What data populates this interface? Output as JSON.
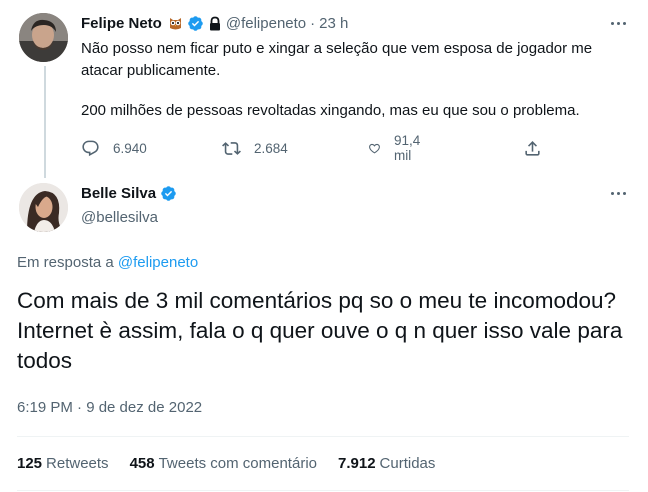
{
  "parent_tweet": {
    "author_name": "Felipe Neto",
    "handle": "@felipeneto",
    "time": "23 h",
    "separator": "·",
    "text_p1": "Não posso nem ficar puto e xingar a seleção que vem esposa de jogador me atacar publicamente.",
    "text_p2": "200 milhões de pessoas revoltadas xingando, mas eu que sou o problema.",
    "replies": "6.940",
    "retweets": "2.684",
    "likes": "91,4 mil"
  },
  "main_tweet": {
    "author_name": "Belle Silva",
    "handle": "@bellesilva",
    "reply_prefix": "Em resposta a",
    "reply_to": "@felipeneto",
    "text": "Com mais de 3 mil comentários pq so o meu te incomodou? Internet è assim, fala o q quer ouve o q n quer isso vale para todos",
    "timestamp": "6:19 PM · 9 de dez de 2022",
    "stats": {
      "retweets_count": "125",
      "retweets_label": "Retweets",
      "quote_count": "458",
      "quote_label": "Tweets com comentário",
      "likes_count": "7.912",
      "likes_label": "Curtidas"
    }
  },
  "colors": {
    "verified": "#1d9bf0",
    "link": "#1d9bf0",
    "muted": "#536471",
    "text": "#0f1419"
  },
  "icons": [
    "verified-badge-icon",
    "owl-emoji-icon",
    "lock-icon",
    "more-icon",
    "reply-icon",
    "retweet-icon",
    "like-icon",
    "share-icon"
  ]
}
